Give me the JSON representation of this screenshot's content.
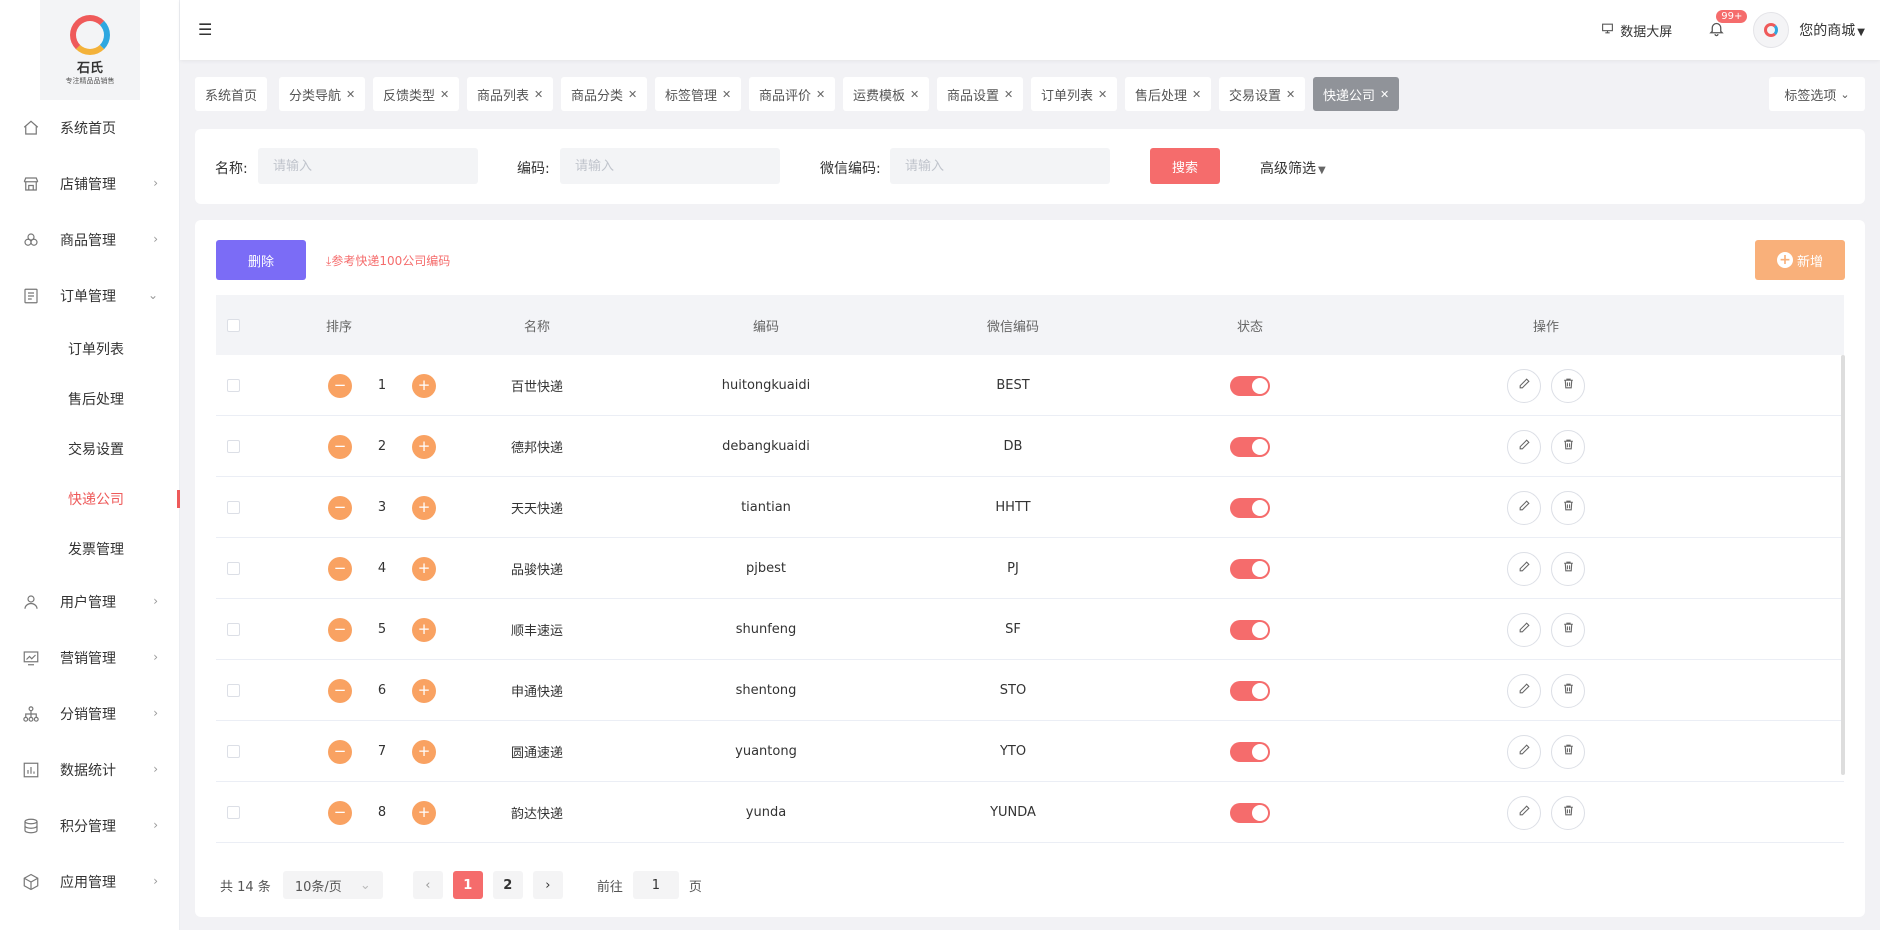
{
  "logo": {
    "text": "石氏",
    "subtitle": "专注精品品销售"
  },
  "sidebar": {
    "items": [
      {
        "label": "系统首页",
        "icon": "home-icon"
      },
      {
        "label": "店铺管理",
        "icon": "store-icon"
      },
      {
        "label": "商品管理",
        "icon": "goods-icon"
      },
      {
        "label": "订单管理",
        "icon": "order-icon"
      },
      {
        "label": "用户管理",
        "icon": "user-icon"
      },
      {
        "label": "营销管理",
        "icon": "marketing-icon"
      },
      {
        "label": "分销管理",
        "icon": "distribution-icon"
      },
      {
        "label": "数据统计",
        "icon": "stats-icon"
      },
      {
        "label": "积分管理",
        "icon": "points-icon"
      },
      {
        "label": "应用管理",
        "icon": "app-icon"
      }
    ],
    "order_sub": [
      "订单列表",
      "售后处理",
      "交易设置",
      "快递公司",
      "发票管理"
    ]
  },
  "topbar": {
    "screen_label": "数据大屏",
    "badge": "99+",
    "shop_label": "您的商城"
  },
  "tags": [
    "系统首页",
    "分类导航",
    "反馈类型",
    "商品列表",
    "商品分类",
    "标签管理",
    "商品评价",
    "运费模板",
    "商品设置",
    "订单列表",
    "售后处理",
    "交易设置",
    "快递公司"
  ],
  "tag_options_label": "标签选项",
  "filter": {
    "name_label": "名称:",
    "code_label": "编码:",
    "wx_label": "微信编码:",
    "placeholder": "请输入",
    "search_label": "搜索",
    "advanced_label": "高级筛选"
  },
  "toolbar": {
    "delete_label": "删除",
    "ref_link": "参考快递100公司编码",
    "add_label": "新增"
  },
  "table": {
    "headers": [
      "排序",
      "名称",
      "编码",
      "微信编码",
      "状态",
      "操作"
    ],
    "rows": [
      {
        "sort": "1",
        "name": "百世快递",
        "code": "huitongkuaidi",
        "wx": "BEST"
      },
      {
        "sort": "2",
        "name": "德邦快递",
        "code": "debangkuaidi",
        "wx": "DB"
      },
      {
        "sort": "3",
        "name": "天天快递",
        "code": "tiantian",
        "wx": "HHTT"
      },
      {
        "sort": "4",
        "name": "品骏快递",
        "code": "pjbest",
        "wx": "PJ"
      },
      {
        "sort": "5",
        "name": "顺丰速运",
        "code": "shunfeng",
        "wx": "SF"
      },
      {
        "sort": "6",
        "name": "申通快递",
        "code": "shentong",
        "wx": "STO"
      },
      {
        "sort": "7",
        "name": "圆通速递",
        "code": "yuantong",
        "wx": "YTO"
      },
      {
        "sort": "8",
        "name": "韵达快递",
        "code": "yunda",
        "wx": "YUNDA"
      }
    ]
  },
  "pager": {
    "total": "共 14 条",
    "size": "10条/页",
    "pages": [
      "1",
      "2"
    ],
    "goto_prefix": "前往",
    "goto_value": "1",
    "goto_suffix": "页"
  },
  "colors": {
    "accent": "#f56c6c",
    "purple": "#7b6cf6",
    "orange": "#f9a262"
  }
}
